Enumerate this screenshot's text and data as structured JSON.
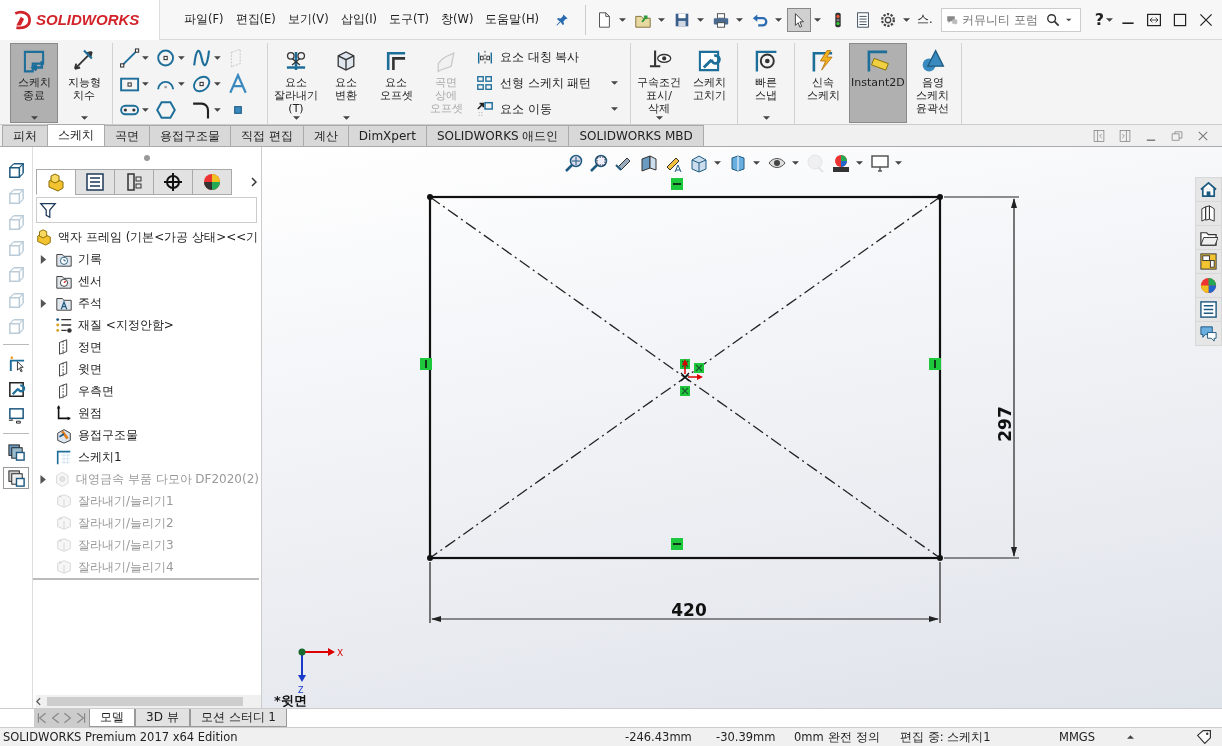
{
  "app": {
    "name": "SOLIDWORKS"
  },
  "menu": [
    {
      "label": "파일(F)"
    },
    {
      "label": "편집(E)"
    },
    {
      "label": "보기(V)"
    },
    {
      "label": "삽입(I)"
    },
    {
      "label": "도구(T)"
    },
    {
      "label": "창(W)"
    },
    {
      "label": "도움말(H)"
    }
  ],
  "quick_toolbar": [
    {
      "dropdown": true,
      "pressed": false
    },
    {
      "dropdown": true,
      "pressed": false
    },
    {
      "dropdown": true,
      "pressed": false
    },
    {
      "dropdown": true,
      "pressed": false
    },
    {
      "dropdown": true,
      "pressed": false
    },
    {
      "dropdown": true,
      "pressed": true
    },
    {
      "dropdown": false,
      "pressed": false
    },
    {
      "dropdown": false,
      "pressed": false
    },
    {
      "dropdown": true,
      "pressed": false
    }
  ],
  "quick_label": "스.",
  "search": {
    "placeholder": "커뮤니티 포럼"
  },
  "help": "?",
  "ribbon": {
    "groups": [
      {
        "tools": [
          {
            "label": "스케치 종료",
            "on": true,
            "disabled": false,
            "dropdown": true
          },
          {
            "label": "지능형 치수",
            "on": false,
            "disabled": false,
            "dropdown": true
          }
        ]
      },
      {
        "tools": [
          {
            "label": "요소 잘라내기(T)",
            "on": false,
            "disabled": false,
            "dropdown": true
          },
          {
            "label": "요소 변환",
            "on": false,
            "disabled": false,
            "dropdown": true
          },
          {
            "label": "요소 오프셋",
            "on": false,
            "disabled": false,
            "dropdown": false
          },
          {
            "label": "곡면 상에 오프셋",
            "on": false,
            "disabled": true,
            "dropdown": false
          }
        ],
        "list": [
          {
            "label": "요소 대칭 복사",
            "dropdown": false
          },
          {
            "label": "선형 스케치 패턴",
            "dropdown": true
          },
          {
            "label": "요소 이동",
            "dropdown": true
          }
        ]
      },
      {
        "tools": [
          {
            "label": "구속조건 표시/삭제",
            "on": false,
            "disabled": false,
            "dropdown": true
          },
          {
            "label": "스케치 고치기",
            "on": false,
            "disabled": false,
            "dropdown": false
          }
        ]
      },
      {
        "tools": [
          {
            "label": "빠른 스냅",
            "on": false,
            "disabled": false,
            "dropdown": true
          }
        ]
      },
      {
        "tools": [
          {
            "label": "신속 스케치",
            "on": false,
            "disabled": false,
            "dropdown": false
          },
          {
            "label": "Instant2D",
            "on": true,
            "disabled": false,
            "dropdown": false
          },
          {
            "label": "음영 스케치 윤곽선",
            "on": false,
            "disabled": false,
            "dropdown": false
          }
        ]
      }
    ]
  },
  "sketch_tools": [
    {
      "dropdown": true,
      "disabled": false
    },
    {
      "dropdown": true,
      "disabled": false
    },
    {
      "dropdown": true,
      "disabled": false
    },
    {
      "dropdown": false,
      "disabled": true
    },
    {
      "dropdown": true,
      "disabled": false
    },
    {
      "dropdown": true,
      "disabled": false
    },
    {
      "dropdown": true,
      "disabled": false
    },
    {
      "dropdown": false,
      "disabled": false
    },
    {
      "dropdown": true,
      "disabled": false
    },
    {
      "dropdown": false,
      "disabled": false
    },
    {
      "dropdown": true,
      "disabled": false
    },
    {
      "dropdown": false,
      "disabled": false
    }
  ],
  "tabs": [
    {
      "label": "피처",
      "selected": false
    },
    {
      "label": "스케치",
      "selected": true
    },
    {
      "label": "곡면",
      "selected": false
    },
    {
      "label": "용접구조물",
      "selected": false
    },
    {
      "label": "직접 편집",
      "selected": false
    },
    {
      "label": "계산",
      "selected": false
    },
    {
      "label": "DimXpert",
      "selected": false
    },
    {
      "label": "SOLIDWORKS 애드인",
      "selected": false
    },
    {
      "label": "SOLIDWORKS MBD",
      "selected": false
    }
  ],
  "side_tools": [
    {
      "disabled": false,
      "selected": false
    },
    {
      "disabled": true,
      "selected": false
    },
    {
      "disabled": true,
      "selected": false
    },
    {
      "disabled": true,
      "selected": false
    },
    {
      "disabled": true,
      "selected": false
    },
    {
      "disabled": true,
      "selected": false
    },
    {
      "disabled": true,
      "selected": false
    },
    {
      "disabled": false,
      "selected": false
    },
    {
      "disabled": false,
      "selected": false
    },
    {
      "disabled": false,
      "selected": false
    },
    {
      "disabled": false,
      "selected": false
    },
    {
      "disabled": false,
      "selected": true
    }
  ],
  "panel_tabs": [
    {
      "selected": true
    },
    {
      "selected": false
    },
    {
      "selected": false
    },
    {
      "selected": false
    },
    {
      "selected": false
    }
  ],
  "tree": {
    "root": "액자 프레임  (기본<가공 상태><<기",
    "items": [
      {
        "label": "기록",
        "expandable": true,
        "suppressed": false
      },
      {
        "label": "센서",
        "expandable": false,
        "suppressed": false
      },
      {
        "label": "주석",
        "expandable": true,
        "suppressed": false
      },
      {
        "label": "재질 <지정안함>",
        "expandable": false,
        "suppressed": false
      },
      {
        "label": "정면",
        "expandable": false,
        "suppressed": false
      },
      {
        "label": "윗면",
        "expandable": false,
        "suppressed": false
      },
      {
        "label": "우측면",
        "expandable": false,
        "suppressed": false
      },
      {
        "label": "원점",
        "expandable": false,
        "suppressed": false
      },
      {
        "label": "용접구조물",
        "expandable": false,
        "suppressed": false
      },
      {
        "label": "스케치1",
        "expandable": false,
        "suppressed": false
      },
      {
        "label": "대영금속 부품 다모아 DF2020(2)",
        "expandable": true,
        "suppressed": true
      },
      {
        "label": "잘라내기/늘리기1",
        "expandable": false,
        "suppressed": true
      },
      {
        "label": "잘라내기/늘리기2",
        "expandable": false,
        "suppressed": true
      },
      {
        "label": "잘라내기/늘리기3",
        "expandable": false,
        "suppressed": true
      },
      {
        "label": "잘라내기/늘리기4",
        "expandable": false,
        "suppressed": true
      }
    ]
  },
  "view_tools": [
    {
      "dropdown": false,
      "disabled": false
    },
    {
      "dropdown": false,
      "disabled": false
    },
    {
      "dropdown": false,
      "disabled": false
    },
    {
      "dropdown": false,
      "disabled": false
    },
    {
      "dropdown": false,
      "disabled": false
    },
    {
      "dropdown": true,
      "disabled": false
    },
    {
      "dropdown": true,
      "disabled": false
    },
    {
      "dropdown": true,
      "disabled": false
    },
    {
      "dropdown": false,
      "disabled": true
    },
    {
      "dropdown": true,
      "disabled": false
    },
    {
      "dropdown": true,
      "disabled": false
    }
  ],
  "sketch": {
    "width_dimension": "420",
    "height_dimension": "297",
    "axis_x": "X",
    "axis_z": "Z",
    "view_name": "*윗면"
  },
  "bottom_tabs": [
    {
      "label": "모델",
      "selected": true
    },
    {
      "label": "3D 뷰",
      "selected": false
    },
    {
      "label": "모션 스터디 1",
      "selected": false
    }
  ],
  "status_bar": {
    "edition": "SOLIDWORKS Premium 2017 x64 Edition",
    "x": "-246.43mm",
    "y": "-30.39mm",
    "z": "0mm",
    "state": "완전 정의",
    "editing": "편집 중: 스케치1",
    "units": "MMGS"
  }
}
